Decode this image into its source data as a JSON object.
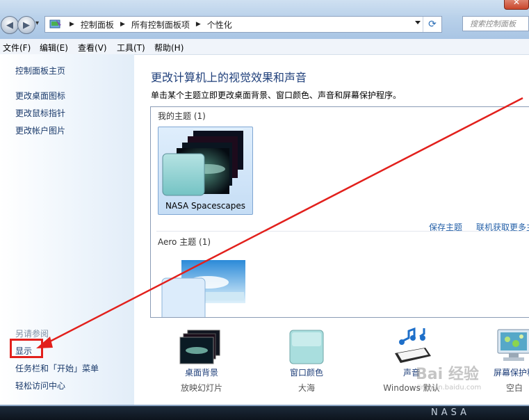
{
  "window": {
    "close_label": "✕"
  },
  "nav": {
    "back_icon": "◀",
    "forward_icon": "▶",
    "recent_icon": "▾"
  },
  "address": {
    "crumbs": [
      "控制面板",
      "所有控制面板项",
      "个性化"
    ],
    "refresh_icon": "⟳"
  },
  "search": {
    "placeholder": "搜索控制面板"
  },
  "menu": [
    {
      "label": "文件(F)"
    },
    {
      "label": "编辑(E)"
    },
    {
      "label": "查看(V)"
    },
    {
      "label": "工具(T)"
    },
    {
      "label": "帮助(H)"
    }
  ],
  "sidebar": {
    "home": "控制面板主页",
    "links": [
      "更改桌面图标",
      "更改鼠标指针",
      "更改帐户图片"
    ],
    "see_also_title": "另请参阅",
    "see_also": [
      "显示",
      "任务栏和「开始」菜单",
      "轻松访问中心"
    ]
  },
  "main": {
    "title": "更改计算机上的视觉效果和声音",
    "subtitle": "单击某个主题立即更改桌面背景、窗口颜色、声音和屏幕保护程序。",
    "my_themes_label": "我的主题 (1)",
    "my_theme_name": "NASA Spacescapes",
    "save_theme": "保存主题",
    "get_more": "联机获取更多主",
    "aero_label": "Aero 主题 (1)"
  },
  "options": [
    {
      "label": "桌面背景",
      "value": "放映幻灯片"
    },
    {
      "label": "窗口颜色",
      "value": "大海"
    },
    {
      "label": "声音",
      "value": "Windows 默认"
    },
    {
      "label": "屏幕保护程",
      "value": "空白"
    }
  ],
  "taskbar": {
    "text": "NASA"
  },
  "watermark": {
    "brand": "Bai 经验",
    "url": "jingyan.baidu.com"
  },
  "colors": {
    "annotation_red": "#e2201c",
    "link_blue": "#2460a8"
  }
}
